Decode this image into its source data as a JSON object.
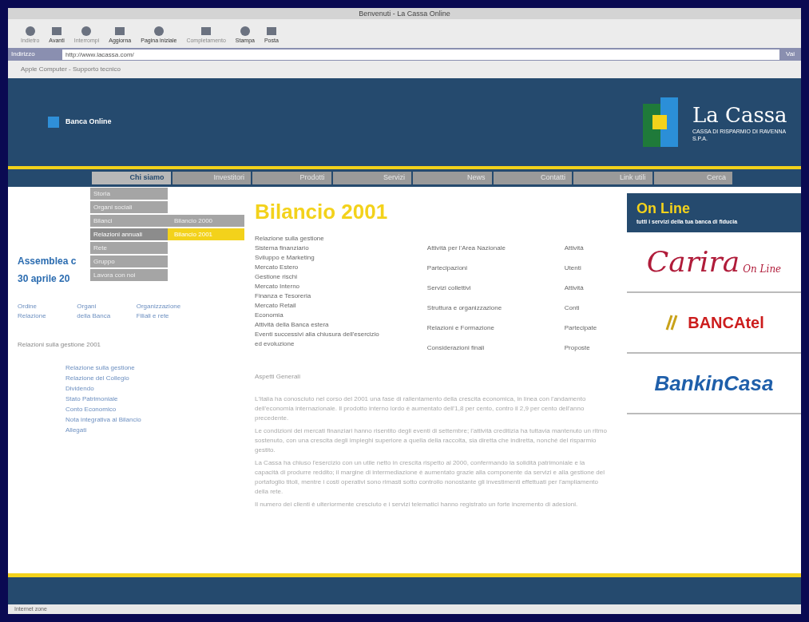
{
  "window": {
    "title": "Benvenuti - La Cassa Online"
  },
  "toolbar": [
    {
      "label": "Indietro",
      "disabled": true
    },
    {
      "label": "Avanti",
      "disabled": false
    },
    {
      "label": "Interrompi",
      "disabled": true
    },
    {
      "label": "Aggiorna",
      "disabled": false
    },
    {
      "label": "Pagina iniziale",
      "disabled": false
    },
    {
      "label": "Completamento",
      "disabled": true
    },
    {
      "label": "Stampa",
      "disabled": false
    },
    {
      "label": "Posta",
      "disabled": false
    }
  ],
  "address_bar": {
    "label": "Indirizzo",
    "value": "http://www.lacassa.com/",
    "go": "Vai"
  },
  "favorites_bar": {
    "label": "Apple Computer - Supporto tecnico"
  },
  "header": {
    "left_label": "Banca Online",
    "logo_name": "La Cassa",
    "logo_sub": "CASSA DI RISPARMIO DI RAVENNA S.P.A."
  },
  "nav": [
    {
      "label": "Chi siamo",
      "selected": true
    },
    {
      "label": "Investitori",
      "selected": false
    },
    {
      "label": "Prodotti",
      "selected": false
    },
    {
      "label": "Servizi",
      "selected": false
    },
    {
      "label": "News",
      "selected": false
    },
    {
      "label": "Contatti",
      "selected": false
    },
    {
      "label": "Link utili",
      "selected": false
    },
    {
      "label": "Cerca",
      "selected": false
    }
  ],
  "dropdown": [
    {
      "label": "Storia",
      "selected": false
    },
    {
      "label": "Organi sociali",
      "selected": false
    },
    {
      "label": "Bilanci",
      "selected": false
    },
    {
      "label": "Relazioni annuali",
      "selected": true
    },
    {
      "label": "Rete",
      "selected": false
    },
    {
      "label": "Gruppo",
      "selected": false
    },
    {
      "label": "Lavora con noi",
      "selected": false
    }
  ],
  "submenu": [
    {
      "label": "Bilancio 2000",
      "selected": false
    },
    {
      "label": "Bilancio 2001",
      "selected": true
    }
  ],
  "left": {
    "title_1": "Assemblea c",
    "title_2": "30 aprile 20",
    "links": [
      "Ordine",
      "Organi",
      "Organizzazione",
      "Relazione",
      "della Banca",
      "Filiali e rete"
    ],
    "section": "Relazioni sulla gestione 2001",
    "list": [
      "Relazione sulla gestione",
      "Relazione del Collegio",
      "Dividendo",
      "Stato Patrimoniale",
      "Conto Economico",
      "Nota integrativa al Bilancio",
      "Allegati"
    ]
  },
  "main": {
    "title": "Bilancio 2001",
    "columns": [
      [
        "Relazione sulla gestione",
        "Sistema finanziario",
        "Sviluppo e Marketing",
        "Mercato Estero",
        "Gestione rischi",
        "Mercato Interno",
        "Finanza e Tesoreria",
        "Mercato Retail",
        "Economia",
        "Attività della Banca estera",
        "Eventi successivi alla chiusura dell'esercizio",
        "ed evoluzione"
      ],
      [
        "Attività per l'Area Nazionale",
        "Partecipazioni",
        "Servizi collettivi",
        "Struttura e organizzazione",
        "Relazioni e Formazione",
        "Considerazioni finali"
      ],
      [
        "Attività",
        "Utenti",
        "Attività",
        "Conti",
        "Partecipate",
        "Proposte"
      ]
    ],
    "section": "Aspetti Generali",
    "paragraphs": [
      "L'Italia ha conosciuto nel corso del 2001 una fase di rallentamento della crescita economica, in linea con l'andamento dell'economia internazionale. Il prodotto interno lordo è aumentato dell'1,8 per cento, contro il 2,9 per cento dell'anno precedente.",
      "Le condizioni dei mercati finanziari hanno risentito degli eventi di settembre; l'attività creditizia ha tuttavia mantenuto un ritmo sostenuto, con una crescita degli impieghi superiore a quella della raccolta, sia diretta che indiretta, nonché del risparmio gestito.",
      "La Cassa ha chiuso l'esercizio con un utile netto in crescita rispetto al 2000, confermando la solidità patrimoniale e la capacità di produrre reddito; il margine di intermediazione è aumentato grazie alla componente da servizi e alla gestione del portafoglio titoli, mentre i costi operativi sono rimasti sotto controllo nonostante gli investimenti effettuati per l'ampliamento della rete.",
      "Il numero dei clienti è ulteriormente cresciuto e i servizi telematici hanno registrato un forte incremento di adesioni."
    ]
  },
  "online": {
    "title": "On Line",
    "subtitle": "tutti i servizi della tua banca di fiducia",
    "services": [
      {
        "kind": "carira",
        "name": "Carira",
        "tag": "On Line"
      },
      {
        "kind": "bancatel",
        "name": "BANCAtel"
      },
      {
        "kind": "bankincasa",
        "name": "BankinCasa"
      }
    ]
  },
  "status_bar": {
    "text": "Internet zone"
  }
}
